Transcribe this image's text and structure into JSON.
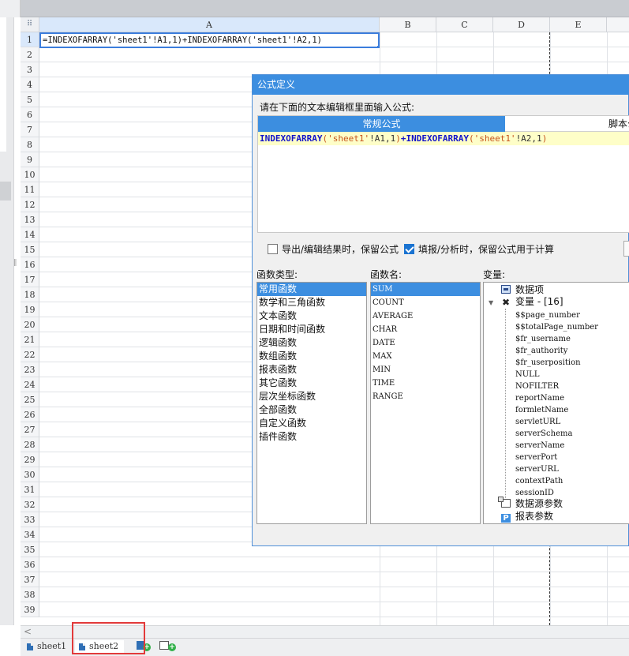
{
  "grid": {
    "columns": [
      "A",
      "B",
      "C",
      "D",
      "E"
    ],
    "rows": [
      "1",
      "2",
      "3",
      "4",
      "5",
      "6",
      "7",
      "8",
      "9",
      "10",
      "11",
      "12",
      "13",
      "14",
      "15",
      "16",
      "17",
      "18",
      "19",
      "20",
      "21",
      "22",
      "23",
      "24",
      "25",
      "26",
      "27",
      "28",
      "29",
      "30",
      "31",
      "32",
      "33",
      "34",
      "35",
      "36",
      "37",
      "38",
      "39"
    ],
    "selected_cell": "A1",
    "cell_a1": "=INDEXOFARRAY('sheet1'!A1,1)+INDEXOFARRAY('sheet1'!A2,1)"
  },
  "sheet_tabs": [
    {
      "label": "sheet1",
      "active": false
    },
    {
      "label": "sheet2",
      "active": true
    }
  ],
  "dialog": {
    "title": "公式定义",
    "prompt": "请在下面的文本编辑框里面输入公式:",
    "tabs": {
      "normal": "常规公式",
      "script": "脚本公式"
    },
    "formula": {
      "fn1": "INDEXOFARRAY",
      "open1": "(",
      "str1": "'sheet1'",
      "ref1": "!A1,1",
      "close1": ")",
      "plus": "+",
      "fn2": "INDEXOFARRAY",
      "open2": "(",
      "str2": "'sheet1'",
      "ref2": "!A2,1",
      "close2": ")"
    },
    "options": {
      "keep_on_export": {
        "label": "导出/编辑结果时，保留公式",
        "checked": false
      },
      "keep_on_fill": {
        "label": "填报/分析时，保留公式用于计算",
        "checked": true
      }
    },
    "function_types_label": "函数类型:",
    "function_names_label": "函数名:",
    "variables_label": "变量:",
    "function_types": [
      "常用函数",
      "数学和三角函数",
      "文本函数",
      "日期和时间函数",
      "逻辑函数",
      "数组函数",
      "报表函数",
      "其它函数",
      "层次坐标函数",
      "全部函数",
      "自定义函数",
      "插件函数"
    ],
    "function_names": [
      "SUM",
      "COUNT",
      "AVERAGE",
      "CHAR",
      "DATE",
      "MAX",
      "MIN",
      "TIME",
      "RANGE"
    ],
    "variables": {
      "data_items": "数据项",
      "variables_node": "变量 - [16]",
      "items": [
        "$$page_number",
        "$$totalPage_number",
        "$fr_username",
        "$fr_authority",
        "$fr_userposition",
        "NULL",
        "NOFILTER",
        "reportName",
        "formletName",
        "servletURL",
        "serverSchema",
        "serverName",
        "serverPort",
        "serverURL",
        "contextPath",
        "sessionID"
      ],
      "datasource_params": "数据源参数",
      "report_params": "报表参数"
    }
  },
  "colors": {
    "accent": "#3c8ee0",
    "selection_border": "#3b7ddd",
    "highlight_box": "#e23a3a",
    "formula_bg": "#fefec8"
  }
}
